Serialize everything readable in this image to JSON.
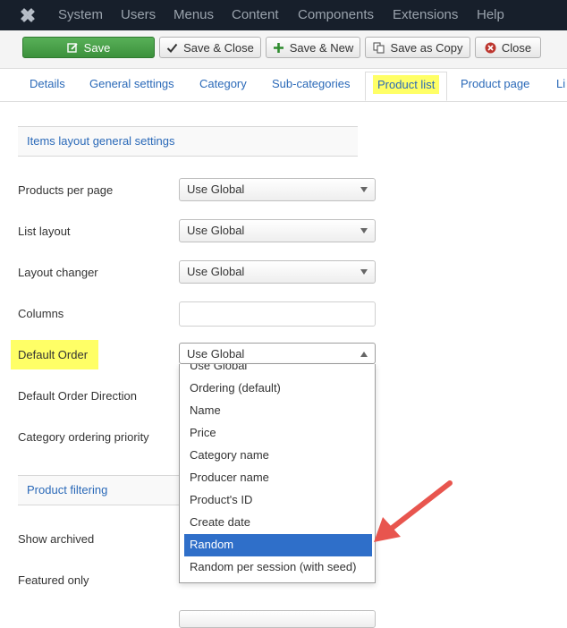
{
  "nav": {
    "items": [
      "System",
      "Users",
      "Menus",
      "Content",
      "Components",
      "Extensions",
      "Help"
    ]
  },
  "toolbar": {
    "save": "Save",
    "save_close": "Save & Close",
    "save_new": "Save & New",
    "save_copy": "Save as Copy",
    "close": "Close"
  },
  "tabs": [
    "Details",
    "General settings",
    "Category",
    "Sub-categories",
    "Product list",
    "Product page",
    "Li"
  ],
  "active_tab": "Product list",
  "sections": {
    "items_layout": "Items layout general settings",
    "product_filtering": "Product filtering"
  },
  "fields": {
    "products_per_page": {
      "label": "Products per page",
      "value": "Use Global"
    },
    "list_layout": {
      "label": "List layout",
      "value": "Use Global"
    },
    "layout_changer": {
      "label": "Layout changer",
      "value": "Use Global"
    },
    "columns": {
      "label": "Columns",
      "value": ""
    },
    "default_order": {
      "label": "Default Order",
      "value": "Use Global"
    },
    "default_order_direction": {
      "label": "Default Order Direction"
    },
    "category_ordering_priority": {
      "label": "Category ordering priority"
    },
    "show_archived": {
      "label": "Show archived"
    },
    "featured_only": {
      "label": "Featured only"
    }
  },
  "dropdown": {
    "options": [
      "Use Global",
      "Ordering (default)",
      "Name",
      "Price",
      "Category name",
      "Producer name",
      "Product's ID",
      "Create date",
      "Random",
      "Random per session (with seed)"
    ],
    "selected": "Random"
  },
  "colors": {
    "navbar": "#171f2b",
    "highlight": "#ffff66",
    "link": "#2a69b8",
    "save_green": "#46a546",
    "selected_option": "#2f6fc9",
    "arrow": "#e8554e"
  }
}
